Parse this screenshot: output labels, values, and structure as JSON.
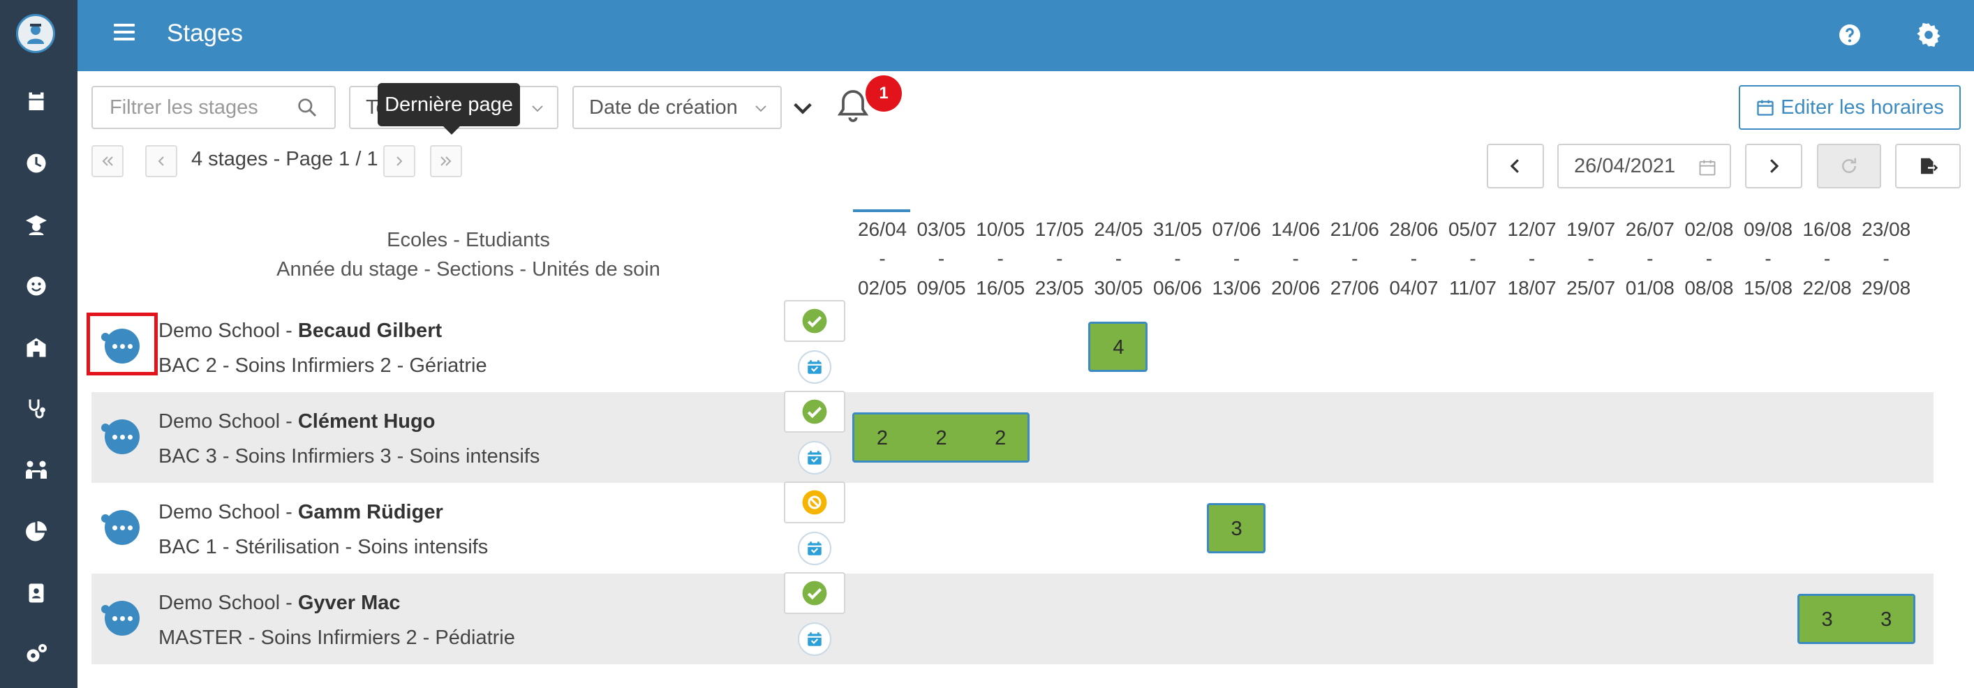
{
  "header": {
    "title": "Stages"
  },
  "filters": {
    "search_placeholder": "Filtrer les stages",
    "type_select": "To",
    "sort_select": "Date de création",
    "notifications_count": "1",
    "tooltip": "Dernière page"
  },
  "actions": {
    "edit_schedule": "Editer les horaires"
  },
  "pagination": {
    "text": "4 stages - Page 1 / 1"
  },
  "date_nav": {
    "date": "26/04/2021"
  },
  "columns": {
    "line1": "Ecoles - Etudiants",
    "line2": "Année du stage - Sections - Unités de soin"
  },
  "weeks": [
    {
      "start": "26/04",
      "end": "02/05"
    },
    {
      "start": "03/05",
      "end": "09/05"
    },
    {
      "start": "10/05",
      "end": "16/05"
    },
    {
      "start": "17/05",
      "end": "23/05"
    },
    {
      "start": "24/05",
      "end": "30/05"
    },
    {
      "start": "31/05",
      "end": "06/06"
    },
    {
      "start": "07/06",
      "end": "13/06"
    },
    {
      "start": "14/06",
      "end": "20/06"
    },
    {
      "start": "21/06",
      "end": "27/06"
    },
    {
      "start": "28/06",
      "end": "04/07"
    },
    {
      "start": "05/07",
      "end": "11/07"
    },
    {
      "start": "12/07",
      "end": "18/07"
    },
    {
      "start": "19/07",
      "end": "25/07"
    },
    {
      "start": "26/07",
      "end": "01/08"
    },
    {
      "start": "02/08",
      "end": "08/08"
    },
    {
      "start": "09/08",
      "end": "15/08"
    },
    {
      "start": "16/08",
      "end": "22/08"
    },
    {
      "start": "23/08",
      "end": "29/08"
    }
  ],
  "week_separator": "-",
  "rows": [
    {
      "school": "Demo School - ",
      "student": "Becaud Gilbert",
      "details": "BAC 2 - Soins Infirmiers 2 - Gériatrie",
      "status": "validated",
      "blocks": [
        {
          "week": 4,
          "weeks": 1,
          "labels": [
            "4"
          ]
        }
      ]
    },
    {
      "school": "Demo School - ",
      "student": "Clément Hugo",
      "details": "BAC 3 - Soins Infirmiers 3 - Soins intensifs",
      "status": "validated",
      "blocks": [
        {
          "week": 0,
          "weeks": 3,
          "labels": [
            "2",
            "2",
            "2"
          ]
        }
      ]
    },
    {
      "school": "Demo School - ",
      "student": "Gamm Rüdiger",
      "details": "BAC 1 - Stérilisation - Soins intensifs",
      "status": "pending",
      "blocks": [
        {
          "week": 6,
          "weeks": 1,
          "labels": [
            "3"
          ]
        }
      ]
    },
    {
      "school": "Demo School - ",
      "student": "Gyver Mac",
      "details": "MASTER - Soins Infirmiers 2 - Pédiatrie",
      "status": "validated",
      "blocks": [
        {
          "week": 16,
          "weeks": 2,
          "labels": [
            "3",
            "3"
          ]
        }
      ]
    }
  ],
  "colors": {
    "primary": "#3b8bc2",
    "sidebar": "#2c3e50",
    "block": "#7cb342",
    "validated": "#7cb342",
    "pending": "#f5b400",
    "badge": "#e3131b"
  },
  "sidebar_icons": [
    "calendar-icon",
    "clock-icon",
    "graduate-icon",
    "smiley-icon",
    "school-icon",
    "stethoscope-icon",
    "people-icon",
    "pie-chart-icon",
    "badge-icon",
    "gears-icon"
  ]
}
